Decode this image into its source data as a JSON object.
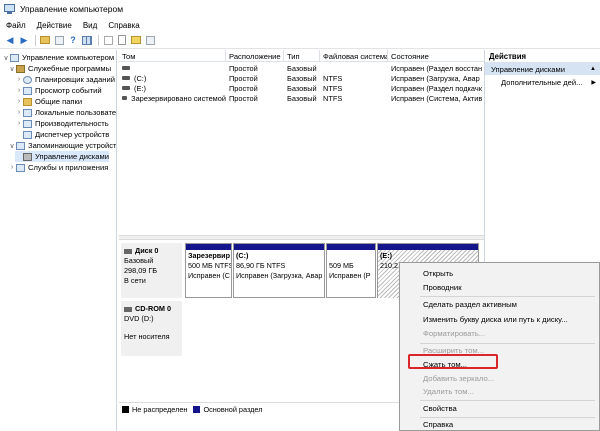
{
  "window": {
    "title": "Управление компьютером"
  },
  "menu": [
    "Файл",
    "Действие",
    "Вид",
    "Справка"
  ],
  "toolbar": {
    "icons": [
      "back-arrow-icon",
      "forward-arrow-icon",
      "folder-up-icon",
      "properties-icon",
      "help-icon",
      "list-view-icon",
      "checkbox-icon",
      "doc-icon",
      "help-doc-icon"
    ]
  },
  "tree": {
    "items": [
      {
        "label": "Управление компьютером (л",
        "indent": 0,
        "arrow": "∨"
      },
      {
        "label": "Служебные программы",
        "indent": 1,
        "arrow": "∨"
      },
      {
        "label": "Планировщик заданий",
        "indent": 2,
        "arrow": "›"
      },
      {
        "label": "Просмотр событий",
        "indent": 2,
        "arrow": "›"
      },
      {
        "label": "Общие папки",
        "indent": 2,
        "arrow": "›"
      },
      {
        "label": "Локальные пользовате",
        "indent": 2,
        "arrow": "›"
      },
      {
        "label": "Производительность",
        "indent": 2,
        "arrow": "›"
      },
      {
        "label": "Диспетчер устройств",
        "indent": 2,
        "arrow": ""
      },
      {
        "label": "Запоминающие устройств",
        "indent": 1,
        "arrow": "∨"
      },
      {
        "label": "Управление дисками",
        "indent": 2,
        "arrow": ""
      },
      {
        "label": "Службы и приложения",
        "indent": 1,
        "arrow": "›"
      }
    ]
  },
  "volume_list": {
    "columns": [
      "Том",
      "Расположение",
      "Тип",
      "Файловая система",
      "Состояние"
    ],
    "rows": [
      [
        "",
        "Простой",
        "Базовый",
        "",
        "Исправен (Раздел восстан"
      ],
      [
        "(C:)",
        "Простой",
        "Базовый",
        "NTFS",
        "Исправен (Загрузка, Авар"
      ],
      [
        "(E:)",
        "Простой",
        "Базовый",
        "NTFS",
        "Исправен (Раздел подкачк"
      ],
      [
        "Зарезервировано системой",
        "Простой",
        "Базовый",
        "NTFS",
        "Исправен (Система, Актив"
      ]
    ]
  },
  "disks": [
    {
      "name": "Диск 0",
      "type": "Базовый",
      "size": "298,09 ГБ",
      "status": "В сети",
      "partitions": [
        {
          "label": "Зарезервир",
          "info": "500 МБ NTFS",
          "state": "Исправен (С"
        },
        {
          "label": "(C:)",
          "info": "86,90 ГБ NTFS",
          "state": "Исправен (Загрузка, Авар"
        },
        {
          "label": "",
          "info": "509 МБ",
          "state": "Исправен (Р"
        },
        {
          "label": "(E:)",
          "info": "210,2",
          "state": ""
        }
      ]
    },
    {
      "name": "CD-ROM 0",
      "type": "DVD (D:)",
      "size": "",
      "status": "Нет носителя"
    }
  ],
  "legend": {
    "unallocated": "Не распределен",
    "primary": "Основной раздел"
  },
  "actions": {
    "title": "Действия",
    "selected": "Управление дисками",
    "more": "Дополнительные дей..."
  },
  "context_menu": {
    "items": [
      {
        "label": "Открыть",
        "enabled": true
      },
      {
        "label": "Проводник",
        "enabled": true
      },
      {
        "label": "Сделать раздел активным",
        "enabled": true
      },
      {
        "label": "Изменить букву диска или путь к диску...",
        "enabled": true
      },
      {
        "label": "Форматировать...",
        "enabled": false
      },
      {
        "label": "Расширить том...",
        "enabled": false
      },
      {
        "label": "Сжать том...",
        "enabled": true
      },
      {
        "label": "Добавить зеркало...",
        "enabled": false
      },
      {
        "label": "Удалить том...",
        "enabled": false
      },
      {
        "label": "Свойства",
        "enabled": true
      },
      {
        "label": "Справка",
        "enabled": true
      }
    ],
    "highlighted": "Сжать том..."
  },
  "colors": {
    "primary_partition": "#14148c",
    "unallocated": "#000000",
    "highlight": "#d9262b",
    "selection": "#d5e3f3"
  }
}
